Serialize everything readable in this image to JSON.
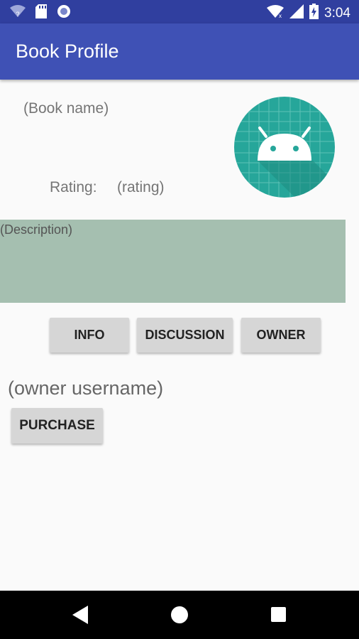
{
  "status_bar": {
    "time": "3:04",
    "icons": [
      "wifi-unknown-icon",
      "sd-card-icon",
      "record-icon",
      "wifi-icon",
      "signal-icon",
      "battery-charging-icon"
    ],
    "background": "#303f9f"
  },
  "app_bar": {
    "title": "Book Profile",
    "background": "#3f51b5"
  },
  "book": {
    "name": "(Book name)",
    "rating_label": "Rating:",
    "rating_value": "(rating)",
    "description": "(Description)",
    "icon": "android-app-icon"
  },
  "tabs": {
    "info": "INFO",
    "discussion": "DISCUSSION",
    "owner": "OWNER"
  },
  "owner": {
    "username": "(owner username)",
    "purchase_label": "PURCHASE"
  },
  "nav_bar": {
    "icons": [
      "back-icon",
      "home-icon",
      "recents-icon"
    ]
  },
  "colors": {
    "accent": "#3f51b5",
    "description_bg": "#a5bfb0",
    "icon_teal": "#26a69a"
  }
}
